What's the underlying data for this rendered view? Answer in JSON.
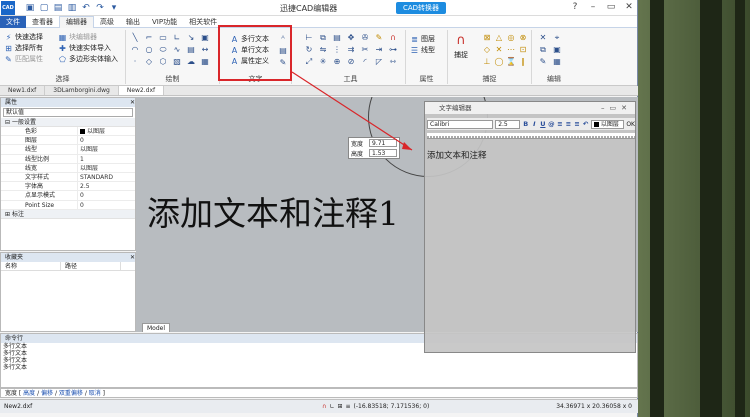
{
  "app": {
    "title": "迅捷CAD编辑器",
    "convert_button": "CAD转换器"
  },
  "menu": [
    "文件",
    "查看器",
    "编辑器",
    "高级",
    "输出",
    "VIP功能",
    "相关软件"
  ],
  "ribbon": {
    "select_group": {
      "label": "选择",
      "buttons": [
        "快速选择",
        "选择所有",
        "匹配属性",
        "块编辑器",
        "快速实体导入",
        "多边形实体输入"
      ]
    },
    "draw_group": {
      "label": "绘制"
    },
    "text_group": {
      "label": "文字",
      "buttons": [
        "多行文本",
        "单行文本",
        "属性定义"
      ]
    },
    "tools_group": {
      "label": "工具"
    },
    "props_group": {
      "label": "属性",
      "buttons": [
        "图层",
        "线型"
      ]
    },
    "snap_group": {
      "label": "捕捉",
      "buttons": [
        "捕捉"
      ]
    },
    "edit_group": {
      "label": "编辑"
    }
  },
  "doc_tabs": [
    "New1.dxf",
    "3DLamborgini.dwg",
    "New2.dxf"
  ],
  "properties": {
    "title": "属性",
    "dropdown": "默认值",
    "section_general": "一般设置",
    "rows": [
      {
        "k": "色彩",
        "v": "以图层"
      },
      {
        "k": "图层",
        "v": "0"
      },
      {
        "k": "线型",
        "v": "以图层"
      },
      {
        "k": "线型比例",
        "v": "1"
      },
      {
        "k": "线宽",
        "v": "以图层"
      },
      {
        "k": "文字样式",
        "v": "STANDARD"
      },
      {
        "k": "字体高",
        "v": "2.5"
      },
      {
        "k": "点显示模式",
        "v": "0"
      },
      {
        "k": "Point Size",
        "v": "0"
      }
    ],
    "section_annot": "标注"
  },
  "favorites": {
    "title": "收藏夹",
    "col_name": "名称",
    "col_path": "路径"
  },
  "canvas": {
    "big_text": "添加文本和注释1",
    "width_label": "宽度",
    "width_value": "9.71",
    "height_label": "高度",
    "height_value": "1.53",
    "model_tab": "Model"
  },
  "text_editor": {
    "title": "文字编辑器",
    "font": "Calibri",
    "size": "2.5",
    "layer": "以图层",
    "ok": "OK",
    "content": "添加文本和注释"
  },
  "command": {
    "title": "命令行",
    "lines": [
      "多行文本",
      "多行文本",
      "多行文本",
      "多行文本"
    ],
    "prompt_label": "宽度",
    "options": [
      "高度",
      "偏移",
      "双重偏移",
      "取消"
    ]
  },
  "status": {
    "file": "New2.dxf",
    "coords": "(-16.83518; 7.171536; 0)",
    "size": "34.36971 x 20.36058 x 0"
  }
}
